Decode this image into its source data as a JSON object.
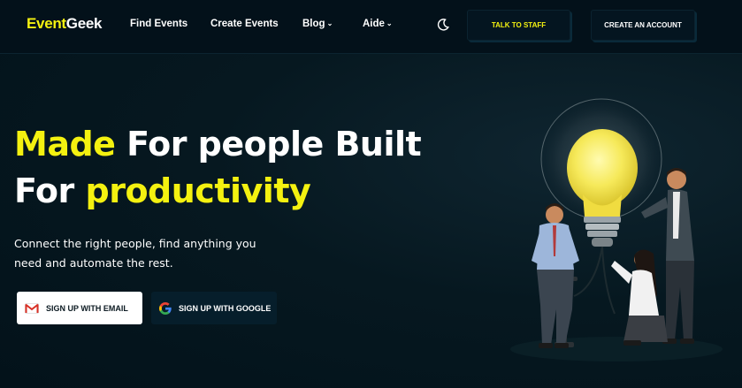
{
  "brand": {
    "part1": "Event",
    "part2": "Geek"
  },
  "nav": {
    "items": [
      {
        "label": "Find Events",
        "dropdown": false
      },
      {
        "label": "Create Events",
        "dropdown": false
      },
      {
        "label": "Blog",
        "dropdown": true
      },
      {
        "label": "Aide",
        "dropdown": true
      }
    ],
    "theme_toggle_icon": "moon-icon",
    "talk_to_staff": "TALK TO STAFF",
    "create_account": "CREATE AN ACCOUNT"
  },
  "hero": {
    "title_line1_highlight": "Made",
    "title_line1_rest": " For people Built",
    "title_line2_start": "For ",
    "title_line2_highlight": "productivity",
    "subtitle": "Connect the right people, find anything you need and automate the rest.",
    "signup_email": "SIGN UP WITH EMAIL",
    "signup_google": "SIGN UP WITH GOOGLE",
    "illustration": "lightbulb-team-illustration"
  },
  "colors": {
    "accent": "#f4f110",
    "background": "#03121a",
    "text": "#ffffff"
  }
}
